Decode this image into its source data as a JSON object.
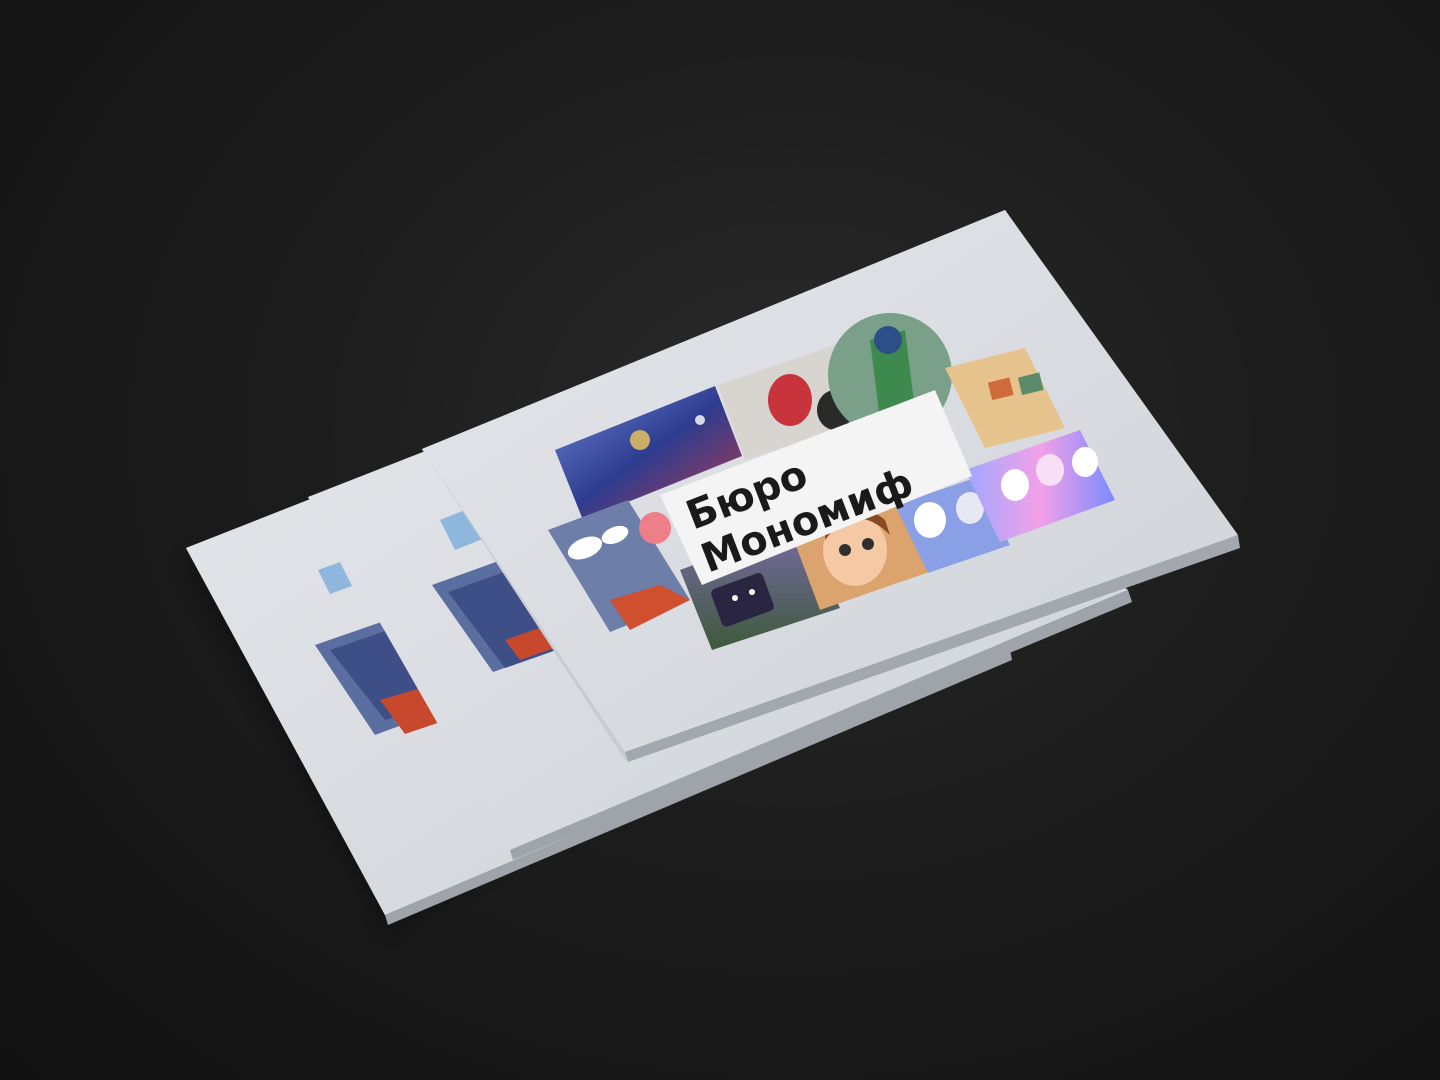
{
  "scene": {
    "description_type": "product-mockup",
    "background_color": "#1a1a1a",
    "booklet_color": "#dfe1e6",
    "label_color": "#f3f3f3"
  },
  "cover": {
    "title_line1": "Бюро",
    "title_line2": "Мономиф"
  },
  "booklets": [
    {
      "name": "booklet-back"
    },
    {
      "name": "booklet-middle"
    },
    {
      "name": "booklet-front"
    }
  ],
  "illustrations": [
    {
      "name": "space-scene-panel",
      "color": "#3a4fa8"
    },
    {
      "name": "red-character-panel",
      "color": "#c8343c"
    },
    {
      "name": "green-character-panel",
      "color": "#4f8e5a"
    },
    {
      "name": "comic-grid-panel",
      "color": "#d59a4a"
    },
    {
      "name": "comic-speech-panel",
      "color": "#5a6d96"
    },
    {
      "name": "pink-monster-panel",
      "color": "#e06a6a"
    },
    {
      "name": "robot-tv-panel",
      "color": "#4b3f6b"
    },
    {
      "name": "girl-portrait-panel",
      "color": "#f0b06a"
    },
    {
      "name": "cats-panel",
      "color": "#6f7fd8"
    },
    {
      "name": "bunnies-panel",
      "color": "#f08fd8"
    }
  ]
}
